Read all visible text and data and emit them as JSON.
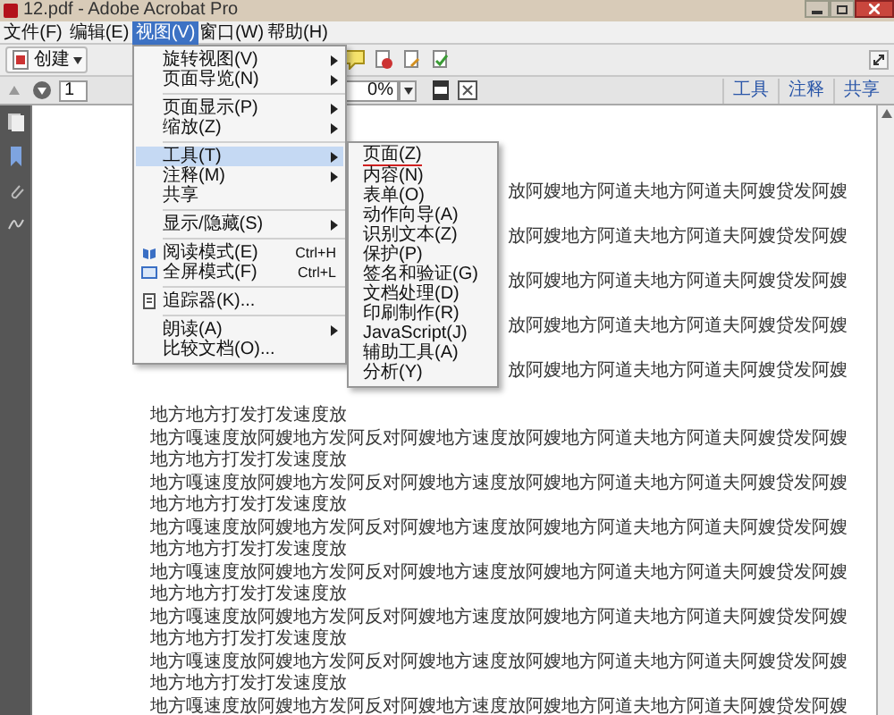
{
  "window": {
    "title": "12.pdf - Adobe Acrobat Pro"
  },
  "menu_bar": [
    {
      "label": "文件(F)",
      "selected": false
    },
    {
      "label": "编辑(E)",
      "selected": false
    },
    {
      "label": "视图(V)",
      "selected": true
    },
    {
      "label": "窗口(W)",
      "selected": false
    },
    {
      "label": "帮助(H)",
      "selected": false
    }
  ],
  "toolbar": {
    "create_button": "创建"
  },
  "nav_bar": {
    "page": "1",
    "zoom": "0%"
  },
  "panel_tabs": [
    {
      "label": "工具"
    },
    {
      "label": "注释"
    },
    {
      "label": "共享"
    }
  ],
  "view_menu": [
    {
      "kind": "item",
      "label": "旋转视图(V)",
      "has_submenu": true,
      "selected": false
    },
    {
      "kind": "item",
      "label": "页面导览(N)",
      "has_submenu": true,
      "selected": false
    },
    {
      "kind": "separator"
    },
    {
      "kind": "item",
      "label": "页面显示(P)",
      "has_submenu": true,
      "selected": false
    },
    {
      "kind": "item",
      "label": "缩放(Z)",
      "has_submenu": true,
      "selected": false
    },
    {
      "kind": "separator"
    },
    {
      "kind": "item",
      "label": "工具(T)",
      "has_submenu": true,
      "selected": true
    },
    {
      "kind": "item",
      "label": "注释(M)",
      "has_submenu": true,
      "selected": false
    },
    {
      "kind": "item",
      "label": "共享",
      "has_submenu": false,
      "selected": false
    },
    {
      "kind": "separator"
    },
    {
      "kind": "item",
      "label": "显示/隐藏(S)",
      "has_submenu": true,
      "selected": false
    },
    {
      "kind": "separator"
    },
    {
      "kind": "item",
      "label": "阅读模式(E)",
      "shortcut": "Ctrl+H",
      "has_icon": true,
      "has_submenu": false,
      "selected": false
    },
    {
      "kind": "item",
      "label": "全屏模式(F)",
      "shortcut": "Ctrl+L",
      "has_icon": true,
      "has_submenu": false,
      "selected": false
    },
    {
      "kind": "separator"
    },
    {
      "kind": "item",
      "label": "追踪器(K)...",
      "has_icon": true,
      "has_submenu": false,
      "selected": false
    },
    {
      "kind": "separator"
    },
    {
      "kind": "item",
      "label": "朗读(A)",
      "has_submenu": true,
      "selected": false
    },
    {
      "kind": "item",
      "label": "比较文档(O)...",
      "has_submenu": false,
      "selected": false
    }
  ],
  "tools_submenu": [
    {
      "label": "页面(Z)",
      "underlined": true
    },
    {
      "label": "内容(N)",
      "underlined": false
    },
    {
      "label": "表单(O)",
      "underlined": false
    },
    {
      "label": "动作向导(A)",
      "underlined": false
    },
    {
      "label": "识别文本(Z)",
      "underlined": false
    },
    {
      "label": "保护(P)",
      "underlined": false
    },
    {
      "label": "签名和验证(G)",
      "underlined": false
    },
    {
      "label": "文档处理(D)",
      "underlined": false
    },
    {
      "label": "印刷制作(R)",
      "underlined": false
    },
    {
      "label": "JavaScript(J)",
      "underlined": false
    },
    {
      "label": "辅助工具(A)",
      "underlined": false
    },
    {
      "label": "分析(Y)",
      "underlined": false
    }
  ],
  "document_lines": [
    {
      "kind": "tail",
      "text": "放阿嫂地方阿道夫地方阿道夫阿嫂贷发阿嫂"
    },
    {
      "kind": "tail",
      "text": "放阿嫂地方阿道夫地方阿道夫阿嫂贷发阿嫂"
    },
    {
      "kind": "tail",
      "text": "放阿嫂地方阿道夫地方阿道夫阿嫂贷发阿嫂"
    },
    {
      "kind": "tail",
      "text": "放阿嫂地方阿道夫地方阿道夫阿嫂贷发阿嫂"
    },
    {
      "kind": "tail",
      "text": "放阿嫂地方阿道夫地方阿道夫阿嫂贷发阿嫂"
    },
    {
      "kind": "full",
      "text": "地方地方打发打发速度放"
    },
    {
      "kind": "full",
      "text": "地方嘎速度放阿嫂地方发阿反对阿嫂地方速度放阿嫂地方阿道夫地方阿道夫阿嫂贷发阿嫂"
    },
    {
      "kind": "full",
      "text": "地方地方打发打发速度放"
    },
    {
      "kind": "full",
      "text": "地方嘎速度放阿嫂地方发阿反对阿嫂地方速度放阿嫂地方阿道夫地方阿道夫阿嫂贷发阿嫂"
    },
    {
      "kind": "full",
      "text": "地方地方打发打发速度放"
    },
    {
      "kind": "full",
      "text": "地方嘎速度放阿嫂地方发阿反对阿嫂地方速度放阿嫂地方阿道夫地方阿道夫阿嫂贷发阿嫂"
    },
    {
      "kind": "full",
      "text": "地方地方打发打发速度放"
    },
    {
      "kind": "full",
      "text": "地方嘎速度放阿嫂地方发阿反对阿嫂地方速度放阿嫂地方阿道夫地方阿道夫阿嫂贷发阿嫂"
    },
    {
      "kind": "full",
      "text": "地方地方打发打发速度放"
    },
    {
      "kind": "full",
      "text": "地方嘎速度放阿嫂地方发阿反对阿嫂地方速度放阿嫂地方阿道夫地方阿道夫阿嫂贷发阿嫂"
    },
    {
      "kind": "full",
      "text": "地方地方打发打发速度放"
    },
    {
      "kind": "full",
      "text": "地方嘎速度放阿嫂地方发阿反对阿嫂地方速度放阿嫂地方阿道夫地方阿道夫阿嫂贷发阿嫂"
    },
    {
      "kind": "full",
      "text": "地方地方打发打发速度放"
    },
    {
      "kind": "full",
      "text": "地方嘎速度放阿嫂地方发阿反对阿嫂地方速度放阿嫂地方阿道夫地方阿道夫阿嫂贷发阿嫂"
    }
  ]
}
